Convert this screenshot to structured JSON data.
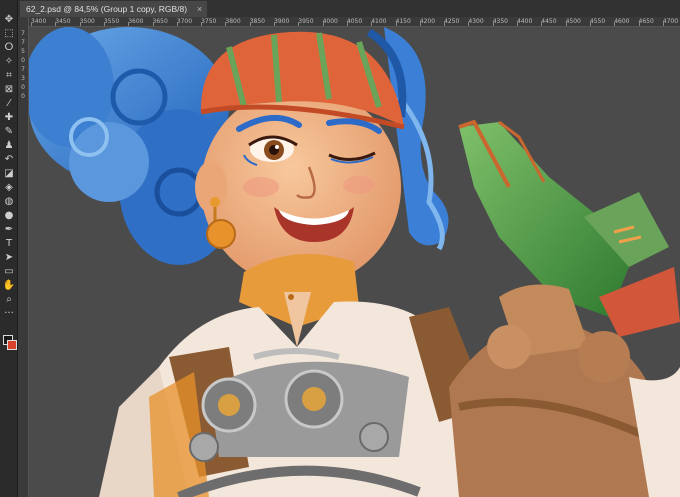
{
  "document": {
    "tab_title": "62_2.psd @ 84,5% (Group 1 copy, RGB/8)",
    "close_glyph": "×"
  },
  "ruler": {
    "h_labels": [
      "3400",
      "3450",
      "3500",
      "3550",
      "3600",
      "3650",
      "3700",
      "3750",
      "3800",
      "3850",
      "3900",
      "3950",
      "4000",
      "4050",
      "4100",
      "4150",
      "4200",
      "4250",
      "4300",
      "4350",
      "4400",
      "4450",
      "4500",
      "4550",
      "4600",
      "4650",
      "4700",
      "4750",
      "4800"
    ],
    "v_labels": [
      "7",
      "7",
      "5",
      "0",
      "7",
      "3",
      "0",
      "0"
    ]
  },
  "toolbar": {
    "tools": [
      {
        "name": "move-tool-icon",
        "glyph": "✥"
      },
      {
        "name": "marquee-tool-icon",
        "glyph": "⬚"
      },
      {
        "name": "lasso-tool-icon",
        "glyph": "ⵔ"
      },
      {
        "name": "magic-wand-tool-icon",
        "glyph": "✧"
      },
      {
        "name": "crop-tool-icon",
        "glyph": "⌗"
      },
      {
        "name": "frame-tool-icon",
        "glyph": "⊠"
      },
      {
        "name": "eyedropper-tool-icon",
        "glyph": "⁄"
      },
      {
        "name": "healing-brush-tool-icon",
        "glyph": "✚"
      },
      {
        "name": "brush-tool-icon",
        "glyph": "✎"
      },
      {
        "name": "clone-stamp-tool-icon",
        "glyph": "♟"
      },
      {
        "name": "history-brush-tool-icon",
        "glyph": "↶"
      },
      {
        "name": "eraser-tool-icon",
        "glyph": "◪"
      },
      {
        "name": "paint-bucket-tool-icon",
        "glyph": "◈"
      },
      {
        "name": "blur-tool-icon",
        "glyph": "◍"
      },
      {
        "name": "dodge-tool-icon",
        "glyph": "●"
      },
      {
        "name": "pen-tool-icon",
        "glyph": "✒"
      },
      {
        "name": "type-tool-icon",
        "glyph": "T"
      },
      {
        "name": "path-selection-tool-icon",
        "glyph": "➤"
      },
      {
        "name": "rectangle-tool-icon",
        "glyph": "▭"
      },
      {
        "name": "hand-tool-icon",
        "glyph": "✋"
      },
      {
        "name": "zoom-tool-icon",
        "glyph": "⌕"
      },
      {
        "name": "more-tools-icon",
        "glyph": "···"
      }
    ],
    "foreground_color": "#1a1a1a",
    "background_color": "#d9432c"
  },
  "colors": {
    "canvas_bg": "#4b4b4b",
    "hair_blue": "#2f6fc6",
    "headscarf_orange": "#e0643a",
    "scarf_stripe_green": "#6aa45a",
    "skin": "#f2b98a",
    "glove_green": "#3f8f3a",
    "shirt_cream": "#f3e6da",
    "leather_brown": "#8a5a32",
    "metal_grey": "#8f8f8f"
  }
}
